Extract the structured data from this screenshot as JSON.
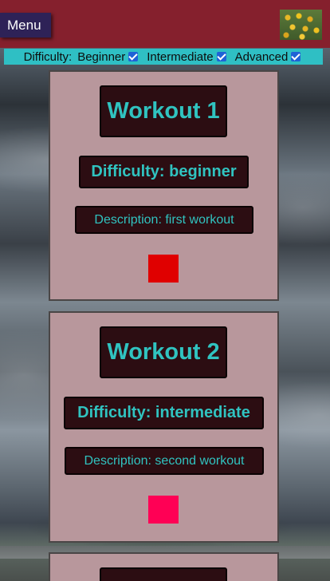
{
  "header": {
    "menu_label": "Menu",
    "logo": "sunflower-field-image"
  },
  "filters": {
    "label": "Difficulty:",
    "options": [
      {
        "label": "Beginner",
        "checked": true
      },
      {
        "label": "Intermediate",
        "checked": true
      },
      {
        "label": "Advanced",
        "checked": true
      }
    ]
  },
  "workouts": [
    {
      "title": "Workout 1",
      "difficulty": "Difficulty: beginner",
      "description": "Description: first workout",
      "color": "#e00000"
    },
    {
      "title": "Workout 2",
      "difficulty": "Difficulty: intermediate",
      "description": "Description: second workout",
      "color": "#ff0055"
    }
  ],
  "colors": {
    "header": "#85202d",
    "menu_button": "#2e2257",
    "filter_bar": "#2fbfc4",
    "card": "#b8979c",
    "pill_bg": "#2c0d12",
    "pill_text": "#30c3c0"
  }
}
